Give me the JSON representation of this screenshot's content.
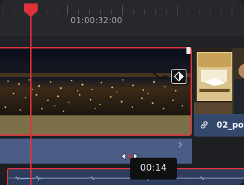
{
  "ruler": {
    "timecode": "01:00:32:00"
  },
  "video_track": {
    "clips": [
      {
        "id": "main",
        "name": "",
        "selected": true,
        "thumbnail": "city-night-aerial"
      },
      {
        "id": "second",
        "name": "02_po",
        "linked_icon": "link-icon",
        "thumbnail": "poster-figure"
      }
    ],
    "keyframe_icons": [
      "keyframe-curve-icon",
      "keyframe-diamond-icon"
    ]
  },
  "audio_track": {
    "chevron_icon": "chevron-right-icon"
  },
  "tooltip": {
    "value": "00:14"
  },
  "cursor": {
    "icon": "trim-cursor-icon"
  },
  "playhead": {
    "icon": "playhead-marker-icon"
  },
  "colors": {
    "playhead": "#e0303a",
    "selection_outline": "#d8333b",
    "video_footer": "#7b7047",
    "audio_band": "#4b5d86",
    "linked_clip": "#34486c"
  }
}
